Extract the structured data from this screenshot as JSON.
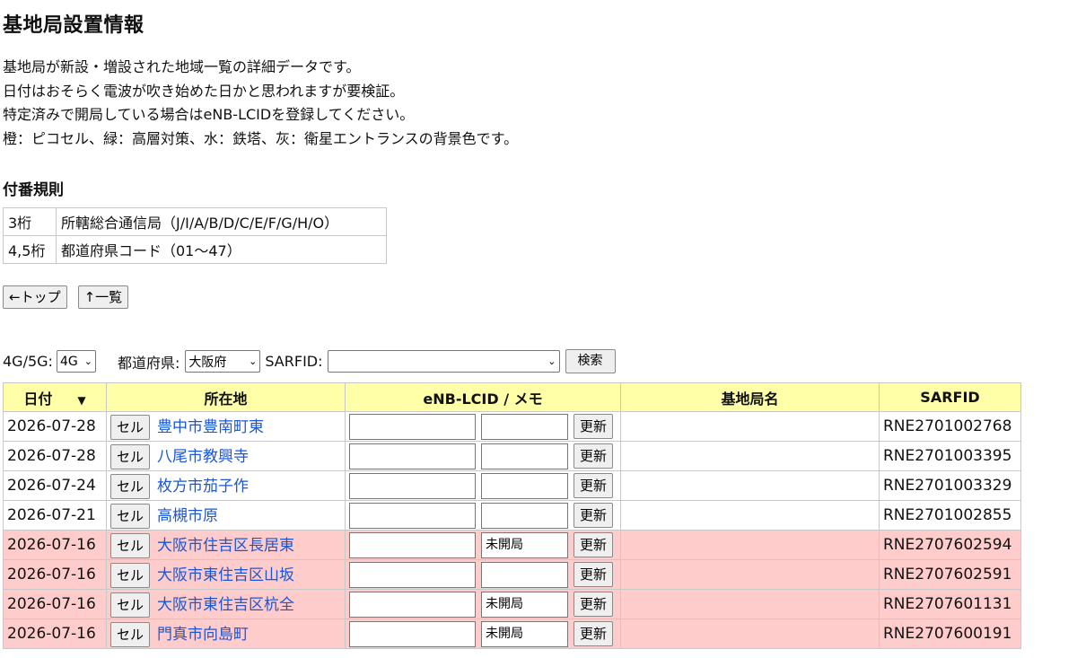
{
  "page": {
    "title": "基地局設置情報",
    "intro": [
      "基地局が新設・増設された地域一覧の詳細データです。",
      "日付はおそらく電波が吹き始めた日かと思われますが要検証。",
      "特定済みで開局している場合はeNB-LCIDを登録してください。",
      "橙：ピコセル、緑：高層対策、水：鉄塔、灰：衛星エントランスの背景色です。"
    ],
    "rules_heading": "付番規則",
    "rules": [
      {
        "key": "3桁",
        "value": "所轄総合通信局（J/I/A/B/D/C/E/F/G/H/O）"
      },
      {
        "key": "4,5桁",
        "value": "都道府県コード（01～47）"
      }
    ]
  },
  "nav": {
    "top_label": "←トップ",
    "list_label": "↑一覧"
  },
  "filters": {
    "gen_label": "4G/5G:",
    "gen_value": "4G",
    "pref_label": "都道府県:",
    "pref_value": "大阪府",
    "sarfid_label": "SARFID:",
    "sarfid_value": "",
    "search_label": "検索"
  },
  "table": {
    "headers": {
      "date": "日付",
      "location": "所在地",
      "enb": "eNB-LCID / メモ",
      "station": "基地局名",
      "sarfid": "SARFID"
    },
    "cell_label": "セル",
    "update_label": "更新",
    "rows": [
      {
        "date": "2026-07-28",
        "location": "豊中市豊南町東",
        "memo": "",
        "sarfid": "RNE2701002768",
        "highlight": false
      },
      {
        "date": "2026-07-28",
        "location": "八尾市教興寺",
        "memo": "",
        "sarfid": "RNE2701003395",
        "highlight": false
      },
      {
        "date": "2026-07-24",
        "location": "枚方市茄子作",
        "memo": "",
        "sarfid": "RNE2701003329",
        "highlight": false
      },
      {
        "date": "2026-07-21",
        "location": "高槻市原",
        "memo": "",
        "sarfid": "RNE2701002855",
        "highlight": false
      },
      {
        "date": "2026-07-16",
        "location": "大阪市住吉区長居東",
        "memo": "未開局",
        "sarfid": "RNE2707602594",
        "highlight": true
      },
      {
        "date": "2026-07-16",
        "location": "大阪市東住吉区山坂",
        "memo": "",
        "sarfid": "RNE2707602591",
        "highlight": true
      },
      {
        "date": "2026-07-16",
        "location": "大阪市東住吉区杭全",
        "memo": "未開局",
        "sarfid": "RNE2707601131",
        "highlight": true
      },
      {
        "date": "2026-07-16",
        "location": "門真市向島町",
        "memo": "未開局",
        "sarfid": "RNE2707600191",
        "highlight": true
      }
    ]
  },
  "colors": {
    "header_bg": "#ffffa8",
    "highlight_bg": "#ffcccc",
    "link": "#1a56d6"
  }
}
